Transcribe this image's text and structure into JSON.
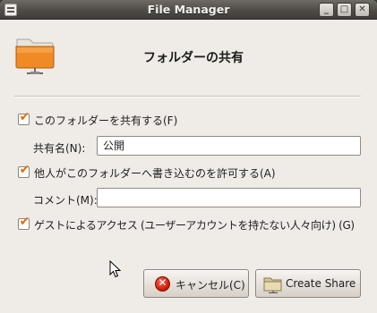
{
  "window": {
    "title": "File Manager",
    "minimize_glyph": "_",
    "maximize_glyph": "□",
    "close_glyph": "✕"
  },
  "dialog": {
    "title": "フォルダーの共有",
    "share_folder_checkbox": {
      "label": "このフォルダーを共有する(F)",
      "checked": true
    },
    "share_name": {
      "label": "共有名(N):",
      "value": "公開"
    },
    "allow_write_checkbox": {
      "label": "他人がこのフォルダーへ書き込むのを許可する(A)",
      "checked": true
    },
    "comment": {
      "label": "コメント(M):",
      "value": ""
    },
    "guest_checkbox": {
      "label": "ゲストによるアクセス (ユーザーアカウントを持たない人々向け) (G)",
      "checked": true
    },
    "buttons": {
      "cancel": "キャンセル(C)",
      "create_share": "Create Share"
    }
  },
  "icons": {
    "dialog_icon": "folder-share-icon",
    "cancel": "cancel-icon",
    "create_share": "share-icon"
  },
  "colors": {
    "titlebar": "#4f4c47",
    "window_bg": "#efebe7",
    "checkbox_tick": "#e36d00",
    "folder": "#f08a24"
  }
}
